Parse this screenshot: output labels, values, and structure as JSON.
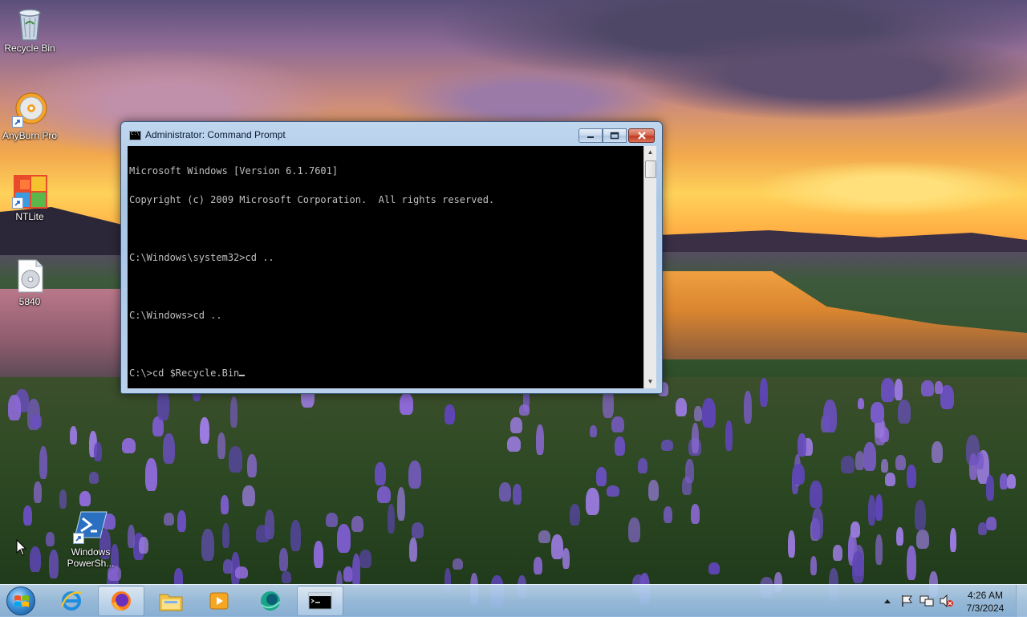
{
  "desktop": {
    "icons": [
      {
        "label": "Recycle Bin",
        "icon": "recycle-bin-icon"
      },
      {
        "label": "AnyBurn Pro",
        "icon": "anyburn-disc-icon"
      },
      {
        "label": "NTLite",
        "icon": "ntlite-icon"
      },
      {
        "label": "5840",
        "icon": "disc-image-file-icon"
      },
      {
        "label": "Windows PowerSh...",
        "icon": "powershell-icon"
      }
    ]
  },
  "window": {
    "title": "Administrator: Command Prompt",
    "icon": "cmd-icon",
    "console_lines": [
      "Microsoft Windows [Version 6.1.7601]",
      "Copyright (c) 2009 Microsoft Corporation.  All rights reserved.",
      "",
      "C:\\Windows\\system32>cd ..",
      "",
      "C:\\Windows>cd ..",
      "",
      "C:\\>cd $Recycle.Bin"
    ],
    "buttons": {
      "minimize": "minimize-icon",
      "maximize": "maximize-icon",
      "close": "close-icon"
    }
  },
  "taskbar": {
    "start": "windows-start-orb-icon",
    "pinned": [
      {
        "icon": "internet-explorer-icon",
        "active": false
      },
      {
        "icon": "firefox-icon",
        "active": true
      },
      {
        "icon": "file-explorer-icon",
        "active": false
      },
      {
        "icon": "media-player-icon",
        "active": false
      },
      {
        "icon": "app-globe-icon",
        "active": false
      },
      {
        "icon": "cmd-icon",
        "active": true
      }
    ],
    "tray": {
      "icons": [
        "show-hidden-icons-chevron",
        "action-center-flag-icon",
        "network-icon",
        "volume-muted-icon"
      ],
      "time": "4:26 AM",
      "date": "7/3/2024"
    }
  },
  "colors": {
    "console_bg": "#000000",
    "console_fg": "#c0c0c0",
    "taskbar": "#a6c4e4",
    "close_button": "#c23a22"
  }
}
